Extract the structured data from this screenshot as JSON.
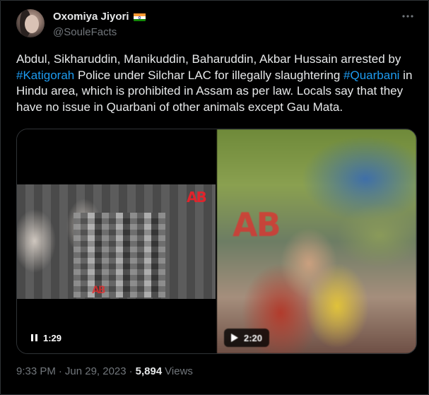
{
  "author": {
    "display_name": "Oxomiya Jiyori",
    "handle": "@SouleFacts",
    "flag": "india-flag-icon"
  },
  "tweet": {
    "text_parts": [
      "Abdul, Sikharuddin, Manikuddin, Baharuddin, Akbar Hussain arrested by ",
      "#Katigorah",
      " Police under Silchar LAC for illegally slaughtering ",
      "#Quarbani",
      " in Hindu area, which is prohibited in Assam as per law. Locals say that they have no issue in Quarbani of other animals except Gau Mata."
    ]
  },
  "media": {
    "video1": {
      "duration": "1:29",
      "watermark": "AB"
    },
    "video2": {
      "duration": "2:20",
      "watermark": "AB"
    }
  },
  "meta": {
    "time": "9:33 PM",
    "separator1": "·",
    "date": "Jun 29, 2023",
    "separator2": "·",
    "views_count": "5,894",
    "views_label": "Views"
  },
  "colors": {
    "background": "#000000",
    "text": "#e7e9ea",
    "secondary": "#71767b",
    "link": "#1d9bf0",
    "border": "#2f3336"
  }
}
